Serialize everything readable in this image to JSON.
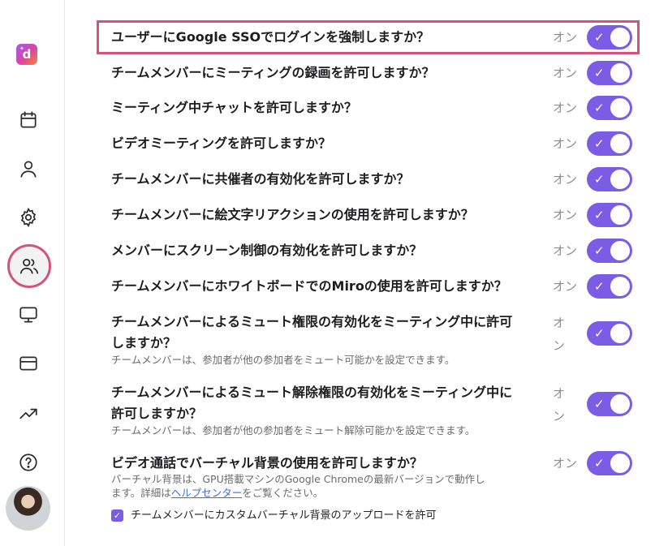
{
  "sidebar": {
    "logo_letter": "d",
    "items": [
      {
        "name": "calendar-icon"
      },
      {
        "name": "user-icon"
      },
      {
        "name": "gear-icon"
      },
      {
        "name": "team-icon",
        "active": true
      },
      {
        "name": "monitor-icon"
      },
      {
        "name": "credit-card-icon"
      },
      {
        "name": "trending-up-icon"
      },
      {
        "name": "help-icon"
      }
    ],
    "avatar": "user-avatar"
  },
  "settings": [
    {
      "question": "ユーザーにGoogle SSOでログインを強制しますか？",
      "state": "オン",
      "enabled": true,
      "highlighted": true
    },
    {
      "question": "チームメンバーにミーティングの録画を許可しますか？",
      "state": "オン",
      "enabled": true
    },
    {
      "question": "ミーティング中チャットを許可しますか？",
      "state": "オン",
      "enabled": true
    },
    {
      "question": "ビデオミーティングを許可しますか？",
      "state": "オン",
      "enabled": true
    },
    {
      "question": "チームメンバーに共催者の有効化を許可しますか？",
      "state": "オン",
      "enabled": true
    },
    {
      "question": "チームメンバーに絵文字リアクションの使用を許可しますか？",
      "state": "オン",
      "enabled": true
    },
    {
      "question": "メンバーにスクリーン制御の有効化を許可しますか？",
      "state": "オン",
      "enabled": true
    },
    {
      "question": "チームメンバーにホワイトボードでのMiroの使用を許可しますか？",
      "state": "オン",
      "enabled": true
    },
    {
      "question_line1": "チームメンバーによるミュート権限の有効化をミーティング中に許可",
      "question_line2": "しますか？",
      "description": "チームメンバーは、参加者が他の参加者をミュート可能かを設定できます。",
      "state_line1": "オ",
      "state_line2": "ン",
      "enabled": true
    },
    {
      "question_line1": "チームメンバーによるミュート解除権限の有効化をミーティング中に",
      "question_line2": "許可しますか？",
      "description": "チームメンバーは、参加者が他の参加者をミュート解除可能かを設定できます。",
      "state_line1": "オ",
      "state_line2": "ン",
      "enabled": true
    },
    {
      "question": "ビデオ通話でバーチャル背景の使用を許可しますか？",
      "description_line1": "バーチャル背景は、GPU搭載マシンのGoogle Chromeの最新バージョンで動作し",
      "description_line2_pre": "ます。詳細は",
      "help_link": "ヘルプセンター",
      "description_line2_post": "をご覧ください。",
      "state": "オン",
      "enabled": true
    }
  ],
  "custom_background": {
    "label": "チームメンバーにカスタムバーチャル背景のアップロードを許可",
    "checked": true
  },
  "colors": {
    "accent": "#7b5ce5",
    "highlight": "#d4537e"
  }
}
